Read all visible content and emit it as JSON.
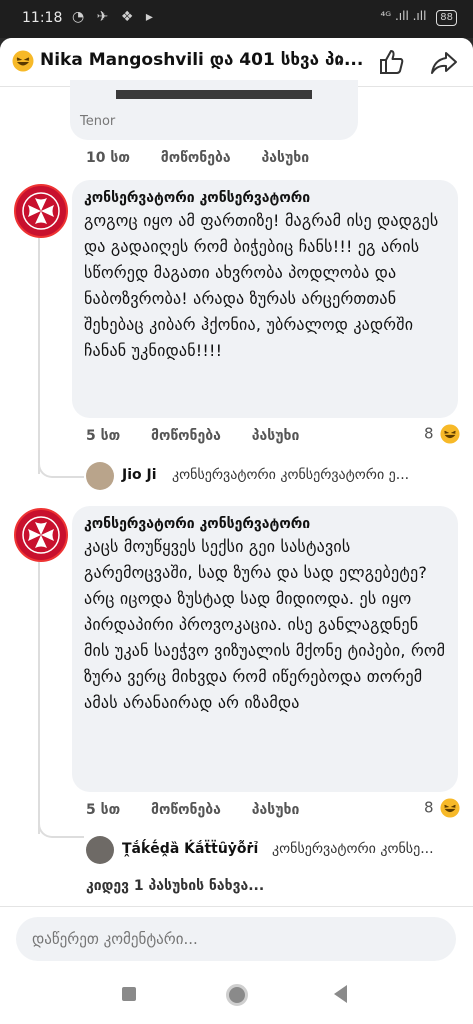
{
  "status_bar": {
    "time": "11:18",
    "icons": "◔ ✈ ❖ ▸",
    "signal": "⁴ᴳ .ıll .ıll",
    "battery": "88"
  },
  "header": {
    "title": "Nika Mangoshvili და 401 სხვა პი...",
    "chevron": "›"
  },
  "gif": {
    "label": "Tenor"
  },
  "top_actions": {
    "time": "10 სთ",
    "like": "მოწონება",
    "reply": "პასუხი"
  },
  "comments": [
    {
      "author": "კონსერვატორი კონსერვატორი",
      "text": "გოგოც იყო ამ ფართიზე! მაგრამ ისე დადგეს და გადაიღეს რომ ბიჭებიც ჩანს!!! ეგ არის სწორედ მაგათი ახვრობა პოდლობა და ნაბოზვრობა! არადა ზურას არცერთთან შეხებაც კიბარ ჰქონია, უბრალოდ კადრში ჩანან უკნიდან!!!!",
      "time": "5 სთ",
      "like": "მოწონება",
      "reply": "პასუხი",
      "reactions": "8",
      "reply_preview": {
        "name": "Jio Ji",
        "text": "კონსერვატორი კონსერვატორი ე..."
      }
    },
    {
      "author": "კონსერვატორი კონსერვატორი",
      "text": "კაცს მოუწყვეს სექსი გეი სასტავის გარემოცვაში, სად ზურა და სად ელგებეტე? არც იცოდა ზუსტად სად მიდიოდა. ეს იყო პირდაპირი პროვოკაცია. ისე განლაგდნენ მის უკან საეჭვო ვიზუალის მქონე ტიპები, რომ ზურა ვერც მიხვდა რომ იწერებოდა თორემ ამას არანაირად არ იზამდა",
      "time": "5 სთ",
      "like": "მოწონება",
      "reply": "პასუხი",
      "reactions": "8",
      "reply_preview": {
        "name": "Ṱắḱḗḓȁ Ḱắẗẗȗẏỗṙỉ",
        "text": "კონსერვატორი კონსე..."
      }
    }
  ],
  "more_replies": "კიდევ 1 პასუხის ნახვა...",
  "composer": {
    "placeholder": "დაწერეთ კომენტარი..."
  },
  "colors": {
    "avatar_red": "#c8102e",
    "bubble": "#f0f2f5",
    "reaction_yellow": "#f7b928"
  }
}
